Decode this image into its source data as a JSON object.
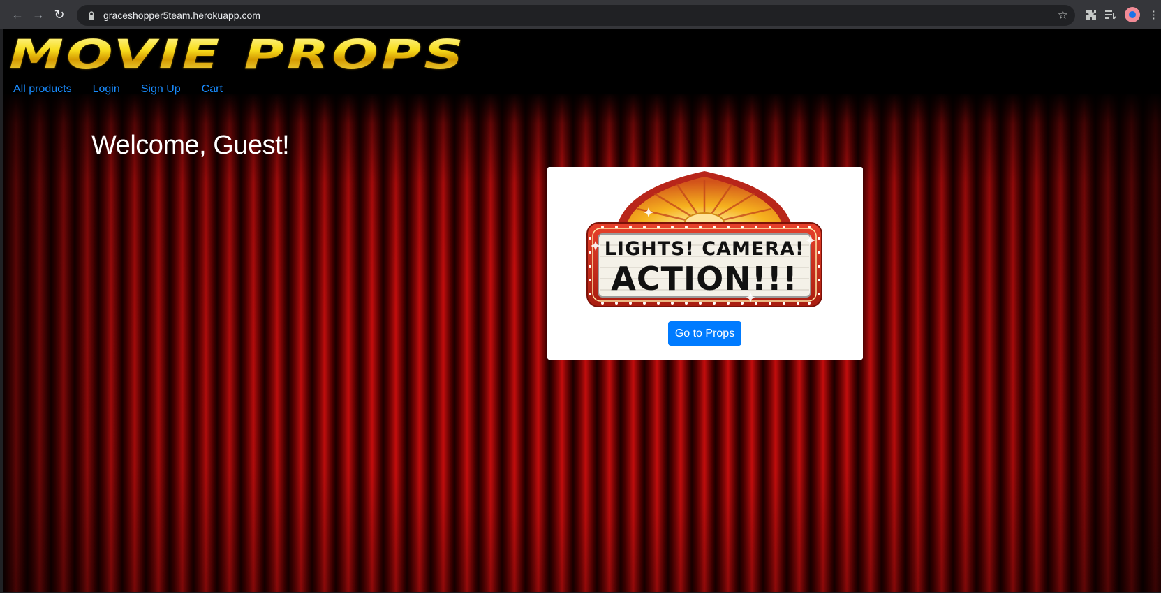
{
  "browser": {
    "url": "graceshopper5team.herokuapp.com",
    "back_icon": "arrow-left-icon",
    "forward_icon": "arrow-right-icon",
    "reload_icon": "reload-icon"
  },
  "site": {
    "logo_text": "MOVIE PROPS",
    "nav": {
      "all_products": "All products",
      "login": "Login",
      "signup": "Sign Up",
      "cart": "Cart"
    }
  },
  "main": {
    "welcome": "Welcome, Guest!",
    "marquee": {
      "line1": "LIGHTS! CAMERA!",
      "line2": "ACTION!!!"
    },
    "cta_label": "Go to Props"
  },
  "colors": {
    "link": "#1a8cff",
    "button": "#007bff",
    "curtain": "#b30000",
    "logo": "#f6d21a"
  }
}
